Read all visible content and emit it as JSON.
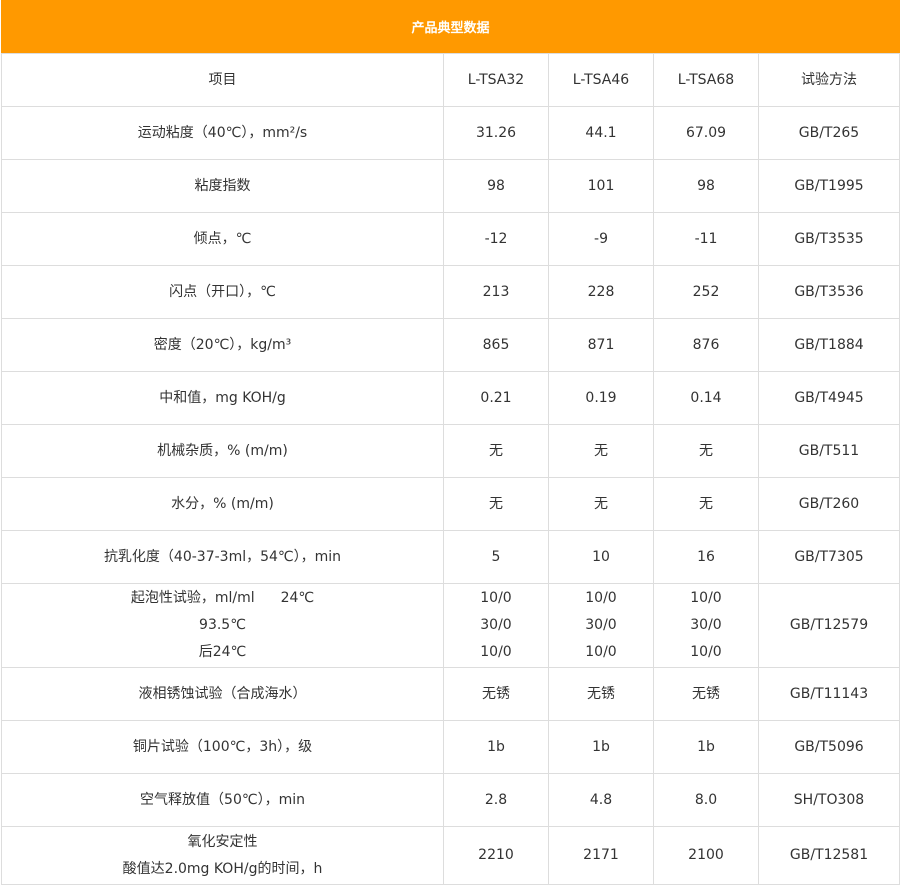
{
  "title": "产品典型数据",
  "header": [
    "项目",
    "L-TSA32",
    "L-TSA46",
    "L-TSA68",
    "试验方法"
  ],
  "rows": [
    {
      "item": "运动粘度（40℃），mm²/s",
      "v32": "31.26",
      "v46": "44.1",
      "v68": "67.09",
      "method": "GB/T265"
    },
    {
      "item": "粘度指数",
      "v32": "98",
      "v46": "101",
      "v68": "98",
      "method": "GB/T1995"
    },
    {
      "item": "倾点，℃",
      "v32": "-12",
      "v46": "-9",
      "v68": "-11",
      "method": "GB/T3535"
    },
    {
      "item": "闪点（开口），℃",
      "v32": "213",
      "v46": "228",
      "v68": "252",
      "method": "GB/T3536"
    },
    {
      "item": "密度（20℃），kg/m³",
      "v32": "865",
      "v46": "871",
      "v68": "876",
      "method": "GB/T1884"
    },
    {
      "item": "中和值，mg KOH/g",
      "v32": "0.21",
      "v46": "0.19",
      "v68": "0.14",
      "method": "GB/T4945"
    },
    {
      "item": "机械杂质，% (m/m)",
      "v32": "无",
      "v46": "无",
      "v68": "无",
      "method": "GB/T511"
    },
    {
      "item": "水分，% (m/m)",
      "v32": "无",
      "v46": "无",
      "v68": "无",
      "method": "GB/T260"
    },
    {
      "item": "抗乳化度（40-37-3ml，54℃），min",
      "v32": "5",
      "v46": "10",
      "v68": "16",
      "method": "GB/T7305"
    }
  ],
  "foam": {
    "item_lines": [
      "起泡性试验，ml/ml",
      "24℃",
      "93.5℃",
      "后24℃"
    ],
    "v32": [
      "10/0",
      "30/0",
      "10/0"
    ],
    "v46": [
      "10/0",
      "30/0",
      "10/0"
    ],
    "v68": [
      "10/0",
      "30/0",
      "10/0"
    ],
    "method": "GB/T12579"
  },
  "rows2": [
    {
      "item": "液相锈蚀试验（合成海水）",
      "v32": "无锈",
      "v46": "无锈",
      "v68": "无锈",
      "method": "GB/T11143"
    },
    {
      "item": "铜片试验（100℃，3h），级",
      "v32": "1b",
      "v46": "1b",
      "v68": "1b",
      "method": "GB/T5096"
    },
    {
      "item": "空气释放值（50℃），min",
      "v32": "2.8",
      "v46": "4.8",
      "v68": "8.0",
      "method": "SH/TO308"
    }
  ],
  "oxidation": {
    "item_lines": [
      "氧化安定性",
      "酸值达2.0mg KOH/g的时间，h"
    ],
    "v32": "2210",
    "v46": "2171",
    "v68": "2100",
    "method": "GB/T12581"
  }
}
